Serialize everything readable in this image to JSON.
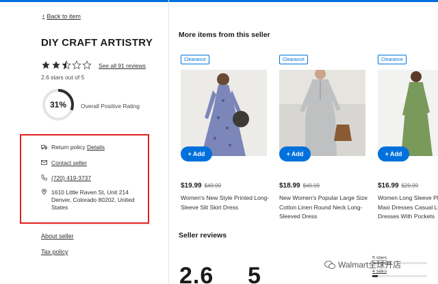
{
  "nav": {
    "back_label": "Back to item"
  },
  "seller": {
    "name": "DIY CRAFT ARTISTRY",
    "see_reviews": "See all 91 reviews",
    "stars_text": "2.6 stars out of 5",
    "rating": 2.6,
    "positive_percent": "31%",
    "positive_fraction": 0.31,
    "positive_label": "Overall Positive Rating"
  },
  "info": {
    "return_policy_label": "Return policy",
    "return_policy_link": "Details",
    "contact_label": "Contact seller",
    "phone": "(720) 419-3737",
    "address": "1610 Little Raven St, Unit 214 Denver, Colorado 80202, United States"
  },
  "links": {
    "about": "About seller",
    "tax": "Tax policy"
  },
  "more_items": {
    "title": "More items from this seller",
    "add_label": "Add",
    "items": [
      {
        "badge": "Clearance",
        "price": "$19.99",
        "was": "$49.99",
        "title": "Women's New Style Printed Long-Sleeve Slit Skirt Dress"
      },
      {
        "badge": "Clearance",
        "price": "$18.99",
        "was": "$49.99",
        "title": "New Women's Popular Large Size Cotton Linen Round Neck Long-Sleeved Dress"
      },
      {
        "badge": "Clearance",
        "price": "$16.99",
        "was": "$29.99",
        "title": "Women Long Sleeve Plain Maxi Dresses Casual Long Dresses With Pockets"
      }
    ]
  },
  "reviews": {
    "title": "Seller reviews",
    "big_left": "2.6",
    "big_right": "5",
    "rows": [
      {
        "label": "5 stars",
        "fraction": 0.35
      },
      {
        "label": "4 stars",
        "fraction": 0.1
      }
    ]
  },
  "watermark": {
    "text": "Walmart全球开店"
  },
  "colors": {
    "accent": "#0071dc",
    "highlight_box": "#e0201f"
  }
}
